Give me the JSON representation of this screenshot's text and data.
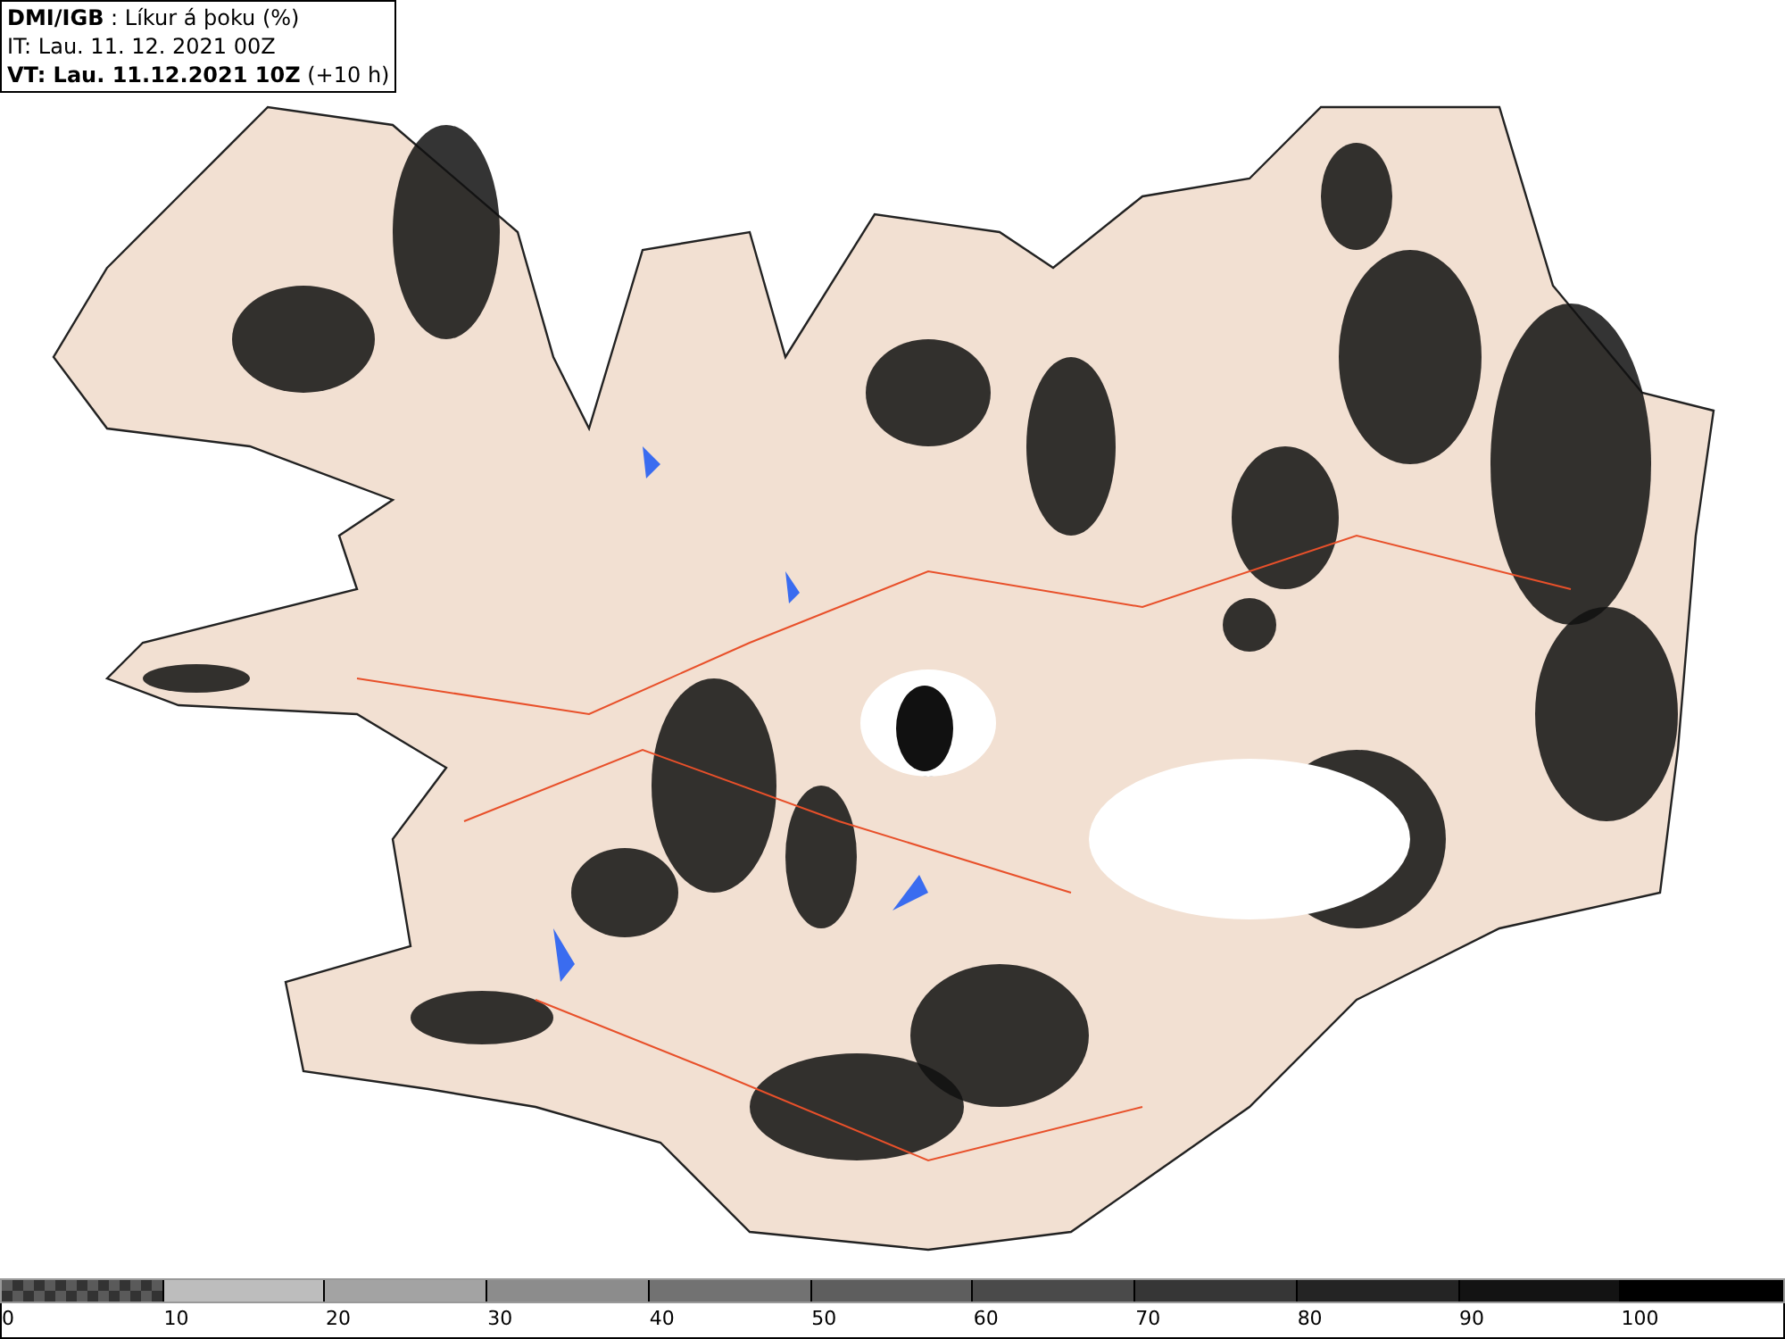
{
  "header": {
    "lines": [
      "**DMI/IGB** : Líkur á þoku (%)",
      "IT: Lau. 11. 12. 2021 00Z",
      "**VT: Lau. 11.12.2021 10Z** (+10 h)"
    ]
  },
  "legend": {
    "segments": [
      {
        "kind": "checker",
        "color": "#5a5a5a"
      },
      {
        "kind": "solid",
        "color": "#bdbdbd"
      },
      {
        "kind": "solid",
        "color": "#a3a3a3"
      },
      {
        "kind": "solid",
        "color": "#8c8c8c"
      },
      {
        "kind": "solid",
        "color": "#727272"
      },
      {
        "kind": "solid",
        "color": "#5e5e5e"
      },
      {
        "kind": "solid",
        "color": "#4a4a4a"
      },
      {
        "kind": "solid",
        "color": "#363636"
      },
      {
        "kind": "solid",
        "color": "#242424"
      },
      {
        "kind": "solid",
        "color": "#131313"
      },
      {
        "kind": "solid",
        "color": "#000000"
      }
    ],
    "labels": [
      "0",
      "10",
      "20",
      "30",
      "40",
      "50",
      "60",
      "70",
      "80",
      "90",
      "100"
    ]
  }
}
